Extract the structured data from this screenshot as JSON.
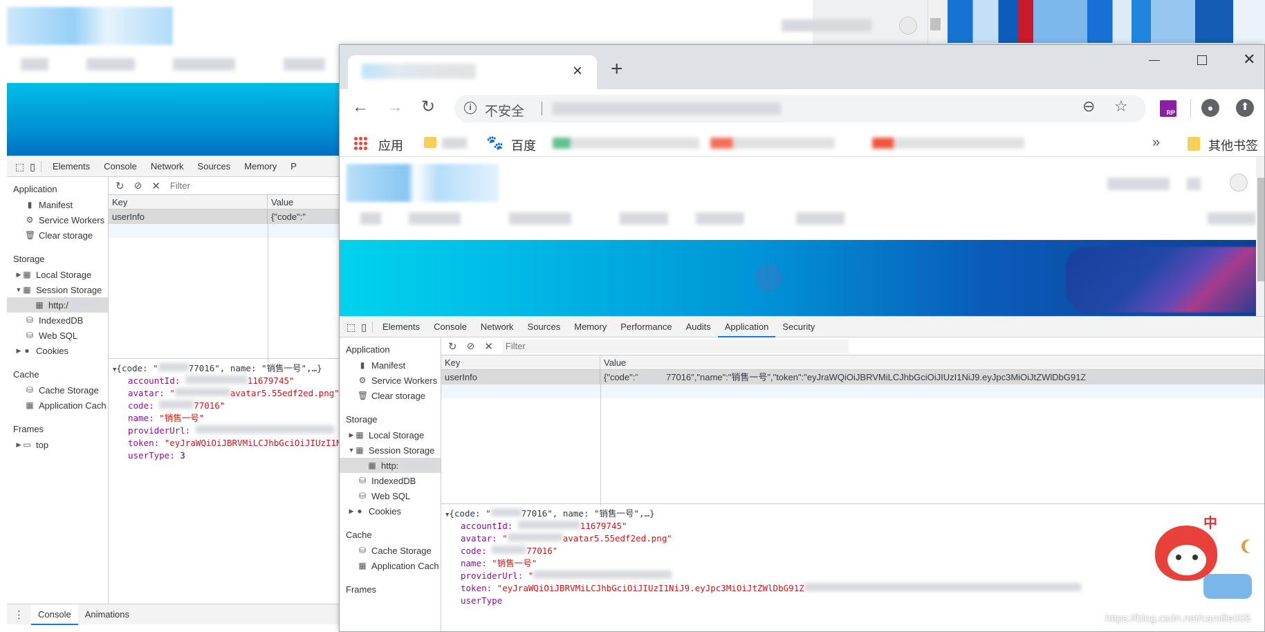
{
  "back_window": {
    "devtools": {
      "tabs": [
        "Elements",
        "Console",
        "Network",
        "Sources",
        "Memory",
        "P"
      ],
      "filter_placeholder": "Filter",
      "sidebar": {
        "application_header": "Application",
        "manifest": "Manifest",
        "service_workers": "Service Workers",
        "clear_storage": "Clear storage",
        "storage_header": "Storage",
        "local_storage": "Local Storage",
        "session_storage": "Session Storage",
        "session_child": "http:/",
        "indexeddb": "IndexedDB",
        "websql": "Web SQL",
        "cookies": "Cookies",
        "cache_header": "Cache",
        "cache_storage": "Cache Storage",
        "application_cache": "Application Cach",
        "frames_header": "Frames",
        "frames_top": "top"
      },
      "table": {
        "key_header": "Key",
        "value_header": "Value",
        "row_key": "userInfo",
        "row_value": "{\"code\":\""
      },
      "preview": {
        "summary_prefix": "{code: \"",
        "summary_suffix": "77016\", name: \"销售一号\",…}",
        "accountid_key": "accountId",
        "accountid_val": "11679745\"",
        "avatar_key": "avatar",
        "avatar_val": "avatar5.55edf2ed.png\"",
        "code_key": "code",
        "code_val": "77016\"",
        "name_key": "name",
        "name_val": "\"销售一号\"",
        "provider_key": "providerUrl",
        "token_key": "token",
        "token_val": "\"eyJraWQiOiJBRVMiLCJhbGciOiJIUzI1N",
        "usertype_key": "userType",
        "usertype_val": "3"
      },
      "drawer_tabs": [
        "Console",
        "Animations"
      ]
    }
  },
  "browser": {
    "tab_close": "×",
    "new_tab": "+",
    "security_label": "不安全",
    "bookmarks": {
      "apps": "应用",
      "baidu": "百度",
      "other": "其他书签",
      "more": "»"
    },
    "ext_label": "RP"
  },
  "devtools": {
    "tabs": [
      "Elements",
      "Console",
      "Network",
      "Sources",
      "Memory",
      "Performance",
      "Audits",
      "Application",
      "Security"
    ],
    "active_tab": "Application",
    "filter_placeholder": "Filter",
    "sidebar": {
      "application_header": "Application",
      "manifest": "Manifest",
      "service_workers": "Service Workers",
      "clear_storage": "Clear storage",
      "storage_header": "Storage",
      "local_storage": "Local Storage",
      "session_storage": "Session Storage",
      "session_child": "http:",
      "indexeddb": "IndexedDB",
      "websql": "Web SQL",
      "cookies": "Cookies",
      "cache_header": "Cache",
      "cache_storage": "Cache Storage",
      "application_cache": "Application Cach",
      "frames_header": "Frames"
    },
    "table": {
      "key_header": "Key",
      "value_header": "Value",
      "row_key": "userInfo",
      "row_value_prefix": "{\"code\":\"",
      "row_value_suffix": "77016\",\"name\":\"销售一号\",\"token\":\"eyJraWQiOiJBRVMiLCJhbGciOiJIUzI1NiJ9.eyJpc3MiOiJtZWlDbG91Z"
    },
    "preview": {
      "summary_prefix": "{code: \"",
      "summary_suffix": "77016\", name: \"销售一号\",…}",
      "accountid_key": "accountId",
      "accountid_val": "11679745\"",
      "avatar_key": "avatar",
      "avatar_val": "avatar5.55edf2ed.png\"",
      "code_key": "code",
      "code_val": "77016\"",
      "name_key": "name",
      "name_val": "\"销售一号\"",
      "provider_key": "providerUrl",
      "provider_val": "\"",
      "token_key": "token",
      "token_val": "\"eyJraWQiOiJBRVMiLCJhbGciOiJIUzI1NiJ9.eyJpc3MiOiJtZWlDbG91Z",
      "usertype_key": "userType"
    }
  },
  "ime_badge": "中",
  "watermark": "https://blog.csdn.net/camille005",
  "colors": {
    "accent": "#1a73e8",
    "string": "#c41a16",
    "key": "#881391",
    "number": "#1c00cf"
  }
}
